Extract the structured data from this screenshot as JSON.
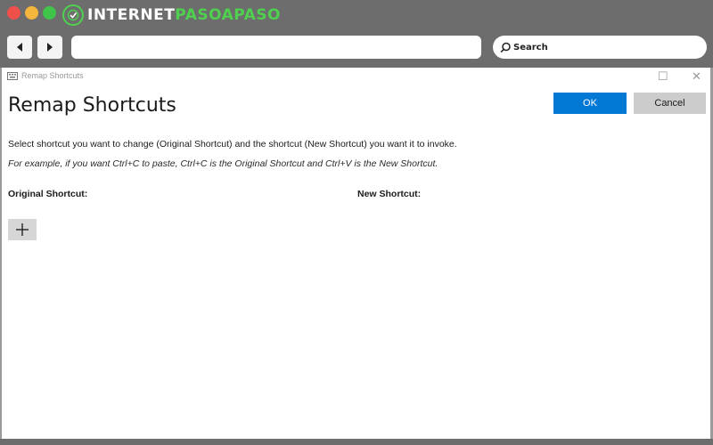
{
  "browser": {
    "brand_prefix": "INTERNET",
    "brand_accent": "PASOAPASO",
    "search_label": "Search",
    "colors": {
      "frame": "#6d6d6d",
      "brand_green": "#4fd14f"
    }
  },
  "window": {
    "title": "Remap Shortcuts"
  },
  "dialog": {
    "heading": "Remap Shortcuts",
    "ok_label": "OK",
    "cancel_label": "Cancel",
    "instruction": "Select shortcut you want to change (Original Shortcut) and the shortcut (New Shortcut) you want it to invoke.",
    "example": "For example, if you want Ctrl+C to paste, Ctrl+C is the Original Shortcut and Ctrl+V is the New Shortcut.",
    "original_header": "Original Shortcut:",
    "new_header": "New Shortcut:",
    "add_icon": "plus-icon",
    "colors": {
      "ok": "#0078d4",
      "cancel": "#cccccc"
    }
  }
}
